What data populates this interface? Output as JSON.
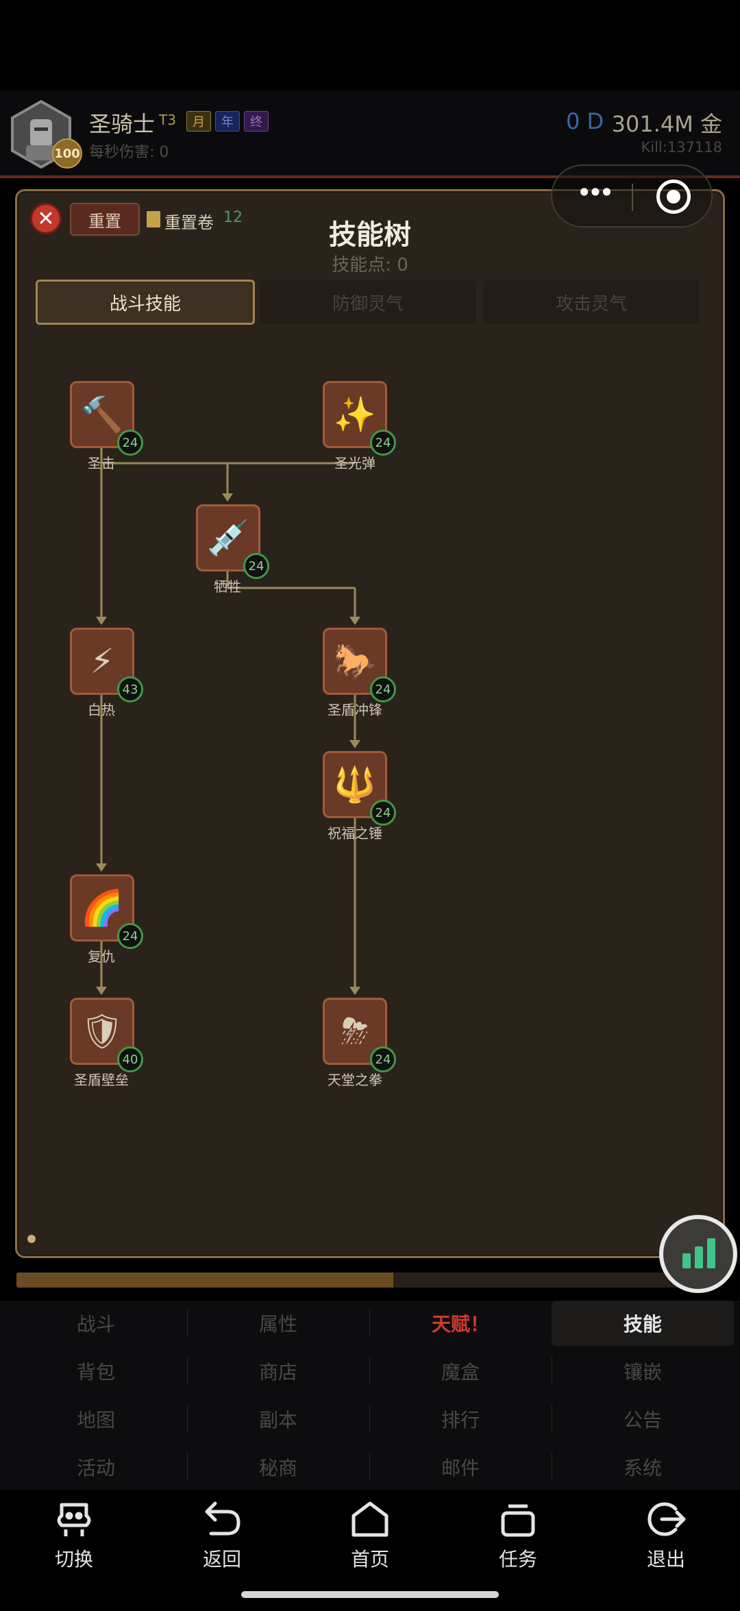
{
  "header": {
    "name": "圣骑士",
    "tier": "T3",
    "pill_month": "月",
    "pill_year": "年",
    "pill_final": "终",
    "level": "100",
    "dps": "每秒伤害: 0",
    "days": "0 D",
    "gold": "301.4M 金",
    "kill": "Kill:137118"
  },
  "panel": {
    "close_icon": "close-icon",
    "reset_label": "重置",
    "reset_scroll_label": "重置卷",
    "reset_scroll_count": "12",
    "title": "技能树",
    "skill_points": "技能点: 0",
    "tabs": [
      "战斗技能",
      "防御灵气",
      "攻击灵气"
    ],
    "active_tab": "战斗技能"
  },
  "skills": [
    {
      "label": "圣击",
      "level": "24",
      "icon": "hammer-icon",
      "glyph": "🔨"
    },
    {
      "label": "圣光弹",
      "level": "24",
      "icon": "sparkles-icon",
      "glyph": "✨"
    },
    {
      "label": "牺牲",
      "level": "24",
      "icon": "syringe-icon",
      "glyph": "💉"
    },
    {
      "label": "白热",
      "level": "43",
      "icon": "lightning-icon",
      "glyph": "⚡"
    },
    {
      "label": "圣盾冲锋",
      "level": "24",
      "icon": "horse-icon",
      "glyph": "🐎"
    },
    {
      "label": "祝福之锤",
      "level": "24",
      "icon": "trident-icon",
      "glyph": "🔱"
    },
    {
      "label": "复仇",
      "level": "24",
      "icon": "rainbow-icon",
      "glyph": "🌈"
    },
    {
      "label": "圣盾壁垒",
      "level": "40",
      "icon": "shield-icon",
      "glyph": "🛡"
    },
    {
      "label": "天堂之拳",
      "level": "24",
      "icon": "storm-icon",
      "glyph": "⛈"
    }
  ],
  "progress": {
    "fraction": 0.55
  },
  "menu": [
    [
      "战斗",
      "属性",
      "天赋！",
      "技能"
    ],
    [
      "背包",
      "商店",
      "魔盒",
      "镶嵌"
    ],
    [
      "地图",
      "副本",
      "排行",
      "公告"
    ],
    [
      "活动",
      "秘商",
      "邮件",
      "系统"
    ]
  ],
  "menu_state": {
    "highlighted": "天赋！",
    "selected": "技能"
  },
  "colors": {
    "accent_gold": "#8b6f45",
    "level_badge_green": "#3f9a44",
    "alert_red": "#d03a2c"
  },
  "navbar": [
    {
      "label": "切换",
      "icon": "switch-icon"
    },
    {
      "label": "返回",
      "icon": "back-icon"
    },
    {
      "label": "首页",
      "icon": "home-icon"
    },
    {
      "label": "任务",
      "icon": "tasks-icon"
    },
    {
      "label": "退出",
      "icon": "exit-icon"
    }
  ]
}
